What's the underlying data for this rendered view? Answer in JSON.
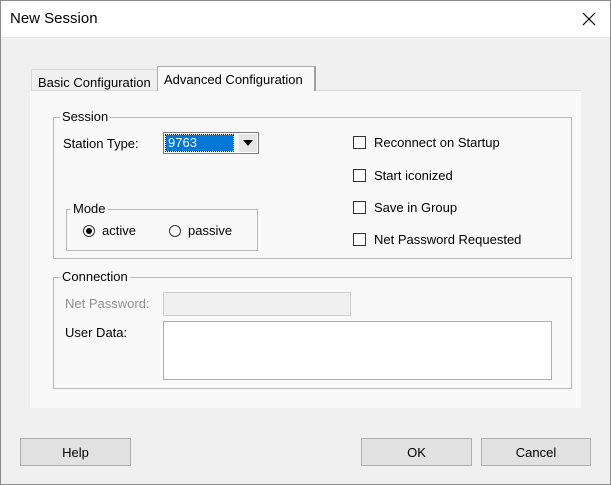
{
  "window": {
    "title": "New Session",
    "close_icon": "close-icon"
  },
  "tabs": [
    {
      "label": "Basic Configuration",
      "selected": false
    },
    {
      "label": "Advanced Configuration",
      "selected": true
    }
  ],
  "session": {
    "group_label": "Session",
    "station_type_label": "Station Type:",
    "station_type_value": "9763",
    "mode": {
      "group_label": "Mode",
      "options": [
        {
          "label": "active",
          "checked": true
        },
        {
          "label": "passive",
          "checked": false
        }
      ]
    },
    "checkboxes": [
      {
        "label": "Reconnect on Startup",
        "checked": false
      },
      {
        "label": "Start iconized",
        "checked": false
      },
      {
        "label": "Save in Group",
        "checked": false
      },
      {
        "label": "Net Password Requested",
        "checked": false
      }
    ]
  },
  "connection": {
    "group_label": "Connection",
    "net_password_label": "Net Password:",
    "net_password_value": "",
    "user_data_label": "User Data:",
    "user_data_value": ""
  },
  "buttons": {
    "help": "Help",
    "ok": "OK",
    "cancel": "Cancel"
  }
}
